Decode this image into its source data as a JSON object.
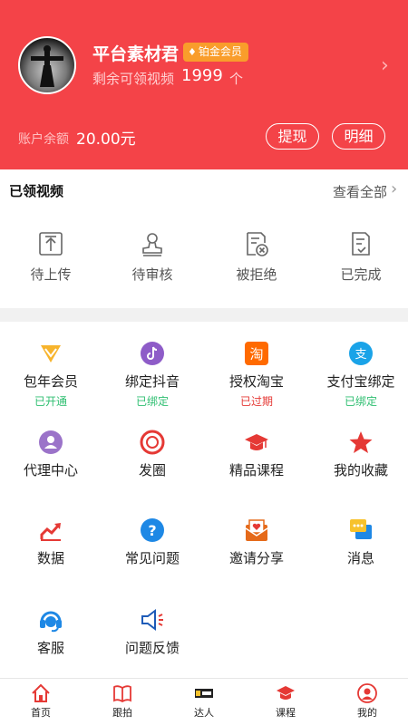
{
  "header": {
    "username": "平台素材君",
    "vip_badge": "铂金会员",
    "remaining_label": "剩余可领视频",
    "remaining_count": "1999",
    "remaining_unit": "个",
    "balance_label": "账户余额",
    "balance_value": "20.00元",
    "withdraw_label": "提现",
    "detail_label": "明细",
    "bg_color": "#f44348",
    "badge_color": "#f99d2b"
  },
  "claimed": {
    "title": "已领视频",
    "view_all": "查看全部",
    "statuses": [
      {
        "label": "待上传",
        "icon": "upload-icon"
      },
      {
        "label": "待审核",
        "icon": "stamp-icon"
      },
      {
        "label": "被拒绝",
        "icon": "rejected-doc-icon"
      },
      {
        "label": "已完成",
        "icon": "completed-doc-icon"
      }
    ]
  },
  "features": [
    {
      "label": "包年会员",
      "status": "已开通",
      "status_color": "#2fbf71",
      "icon": "vip-crown-icon"
    },
    {
      "label": "绑定抖音",
      "status": "已绑定",
      "status_color": "#2fbf71",
      "icon": "douyin-icon"
    },
    {
      "label": "授权淘宝",
      "status": "已过期",
      "status_color": "#e53935",
      "icon": "taobao-icon"
    },
    {
      "label": "支付宝绑定",
      "status": "已绑定",
      "status_color": "#2fbf71",
      "icon": "alipay-icon"
    },
    {
      "label": "代理中心",
      "icon": "agent-icon"
    },
    {
      "label": "发圈",
      "icon": "moments-icon"
    },
    {
      "label": "精品课程",
      "icon": "graduation-cap-icon"
    },
    {
      "label": "我的收藏",
      "icon": "star-icon"
    },
    {
      "label": "数据",
      "icon": "chart-icon"
    },
    {
      "label": "常见问题",
      "icon": "question-icon"
    },
    {
      "label": "邀请分享",
      "icon": "invite-mail-icon"
    },
    {
      "label": "消息",
      "icon": "message-icon"
    },
    {
      "label": "客服",
      "icon": "headset-icon"
    },
    {
      "label": "问题反馈",
      "icon": "speaker-icon"
    }
  ],
  "bottom_nav": [
    {
      "label": "首页",
      "icon": "home-icon",
      "active": true
    },
    {
      "label": "跟拍",
      "icon": "book-icon"
    },
    {
      "label": "达人",
      "icon": "talent-icon"
    },
    {
      "label": "课程",
      "icon": "graduation-cap-icon"
    },
    {
      "label": "我的",
      "icon": "profile-icon"
    }
  ]
}
